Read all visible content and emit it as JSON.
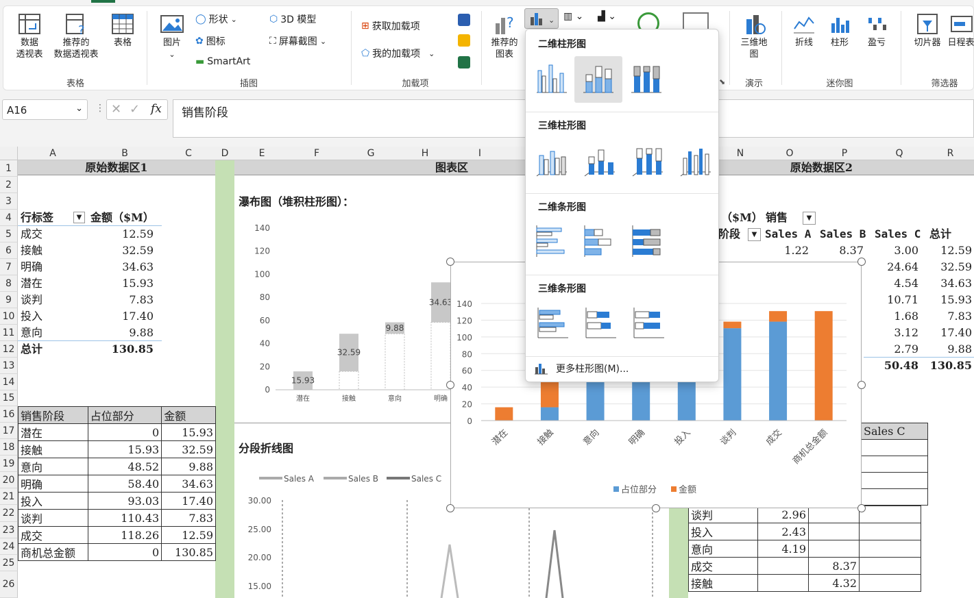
{
  "ribbon": {
    "groups": [
      {
        "id": "tables",
        "label": "表格"
      },
      {
        "id": "illustrations",
        "label": "插图"
      },
      {
        "id": "addins",
        "label": "加载项"
      },
      {
        "id": "tours",
        "label": "演示"
      },
      {
        "id": "sparklines",
        "label": "迷你图"
      },
      {
        "id": "filters",
        "label": "筛选器"
      }
    ],
    "pivot_table": "数据\n透视表",
    "recommended_pivot": "推荐的\n数据透视表",
    "table": "表格",
    "pictures": "图片",
    "shapes": "形状",
    "icons": "图标",
    "smartart": "SmartArt",
    "model3d": "3D 模型",
    "screenshot": "屏幕截图",
    "get_addins": "获取加载项",
    "my_addins": "我的加载项",
    "recommended_charts": "推荐的\n图表",
    "map3d": "三维地\n图",
    "sparkline_line": "折线",
    "sparkline_column": "柱形",
    "sparkline_winloss": "盈亏",
    "slicer": "切片器",
    "timeline": "日程表"
  },
  "formula_bar": {
    "name_box": "A16",
    "formula": "销售阶段"
  },
  "columns": [
    "A",
    "B",
    "C",
    "D",
    "E",
    "F",
    "G",
    "H",
    "I",
    "N",
    "O",
    "P",
    "Q",
    "R"
  ],
  "rows": [
    "1",
    "2",
    "3",
    "4",
    "5",
    "6",
    "7",
    "8",
    "9",
    "10",
    "11",
    "12",
    "13",
    "14",
    "15",
    "16",
    "17",
    "18",
    "19",
    "20",
    "21",
    "22",
    "23",
    "24",
    "25",
    "26"
  ],
  "sheet": {
    "header_left": "原始数据区1",
    "header_mid": "图表区",
    "header_right": "原始数据区2",
    "pivot1_label": "行标签",
    "pivot1_value": "金额（$M）",
    "pivot1_rows": [
      {
        "k": "成交",
        "v": "12.59"
      },
      {
        "k": "接触",
        "v": "32.59"
      },
      {
        "k": "明确",
        "v": "34.63"
      },
      {
        "k": "潜在",
        "v": "15.93"
      },
      {
        "k": "谈判",
        "v": "7.83"
      },
      {
        "k": "投入",
        "v": "17.40"
      },
      {
        "k": "意向",
        "v": "9.88"
      }
    ],
    "pivot1_total_label": "总计",
    "pivot1_total": "130.85",
    "table2_headers": [
      "销售阶段",
      "占位部分",
      "金额"
    ],
    "table2_rows": [
      [
        "潜在",
        "0",
        "15.93"
      ],
      [
        "接触",
        "15.93",
        "32.59"
      ],
      [
        "意向",
        "48.52",
        "9.88"
      ],
      [
        "明确",
        "58.40",
        "34.63"
      ],
      [
        "投入",
        "93.03",
        "17.40"
      ],
      [
        "谈判",
        "110.43",
        "7.83"
      ],
      [
        "成交",
        "118.26",
        "12.59"
      ],
      [
        "商机总金额",
        "0",
        "130.85"
      ]
    ],
    "waterfall_title": "瀑布图（堆积柱形图）：",
    "line_title": "分段折线图",
    "pivot2_value_header": "（$M）",
    "pivot2_sales": "销售",
    "pivot2_stage": "阶段",
    "pivot2_cols": [
      "Sales A",
      "Sales B",
      "Sales C",
      "总计"
    ],
    "pivot2_row1": [
      "1.22",
      "8.37",
      "3.00",
      "12.59"
    ],
    "pivot2_col_q": [
      "24.64",
      "4.54",
      "10.71",
      "1.68",
      "3.12",
      "2.79"
    ],
    "pivot2_col_r": [
      "32.59",
      "34.63",
      "15.93",
      "7.83",
      "17.40",
      "9.88"
    ],
    "pivot2_total_q": "50.48",
    "pivot2_total_r": "130.85",
    "table3_header": "Sales C",
    "table3_rows": [
      {
        "k": "谈判",
        "b": "2.96",
        "c": ""
      },
      {
        "k": "投入",
        "b": "2.43",
        "c": ""
      },
      {
        "k": "意向",
        "b": "4.19",
        "c": ""
      },
      {
        "k": "成交",
        "b": "",
        "c": "8.37"
      },
      {
        "k": "接触",
        "b": "",
        "c": "4.32"
      }
    ]
  },
  "bg_chart_legend": [
    "Sales A",
    "Sales B",
    "Sales C"
  ],
  "chart_data": [
    {
      "type": "bar",
      "title": "",
      "categories": [
        "潜在",
        "接触",
        "意向",
        "明确"
      ],
      "series": [
        {
          "values": [
            15.93,
            32.59,
            9.88,
            34.63
          ]
        }
      ],
      "ylim": [
        0,
        140
      ],
      "yticks": [
        "0",
        "20",
        "40",
        "60",
        "80",
        "100",
        "120",
        "140"
      ],
      "data_labels": [
        "15.93",
        "32.59",
        "9.88",
        "34.63"
      ]
    },
    {
      "type": "bar",
      "stacked": true,
      "categories": [
        "潜在",
        "接触",
        "意向",
        "明确",
        "投入",
        "谈判",
        "成交",
        "商机总金额"
      ],
      "series": [
        {
          "name": "占位部分",
          "values": [
            0,
            15.93,
            48.52,
            58.4,
            93.03,
            110.43,
            118.26,
            0
          ],
          "color": "#5b9bd5"
        },
        {
          "name": "金额",
          "values": [
            15.93,
            32.59,
            9.88,
            34.63,
            17.4,
            7.83,
            12.59,
            130.85
          ],
          "color": "#ed7d31"
        }
      ],
      "ylim": [
        0,
        140
      ],
      "yticks": [
        "0",
        "20",
        "40",
        "60",
        "80",
        "100",
        "120",
        "140"
      ],
      "legend": "bottom"
    },
    {
      "type": "line",
      "series": [
        {
          "name": "Sales A"
        },
        {
          "name": "Sales B"
        },
        {
          "name": "Sales C"
        }
      ],
      "yticks": [
        "15.00",
        "20.00",
        "25.00",
        "30.00"
      ],
      "legend": "top"
    }
  ],
  "dropdown": {
    "sections": [
      "二维柱形图",
      "三维柱形图",
      "二维条形图",
      "三维条形图"
    ],
    "more": "更多柱形图(M)..."
  }
}
